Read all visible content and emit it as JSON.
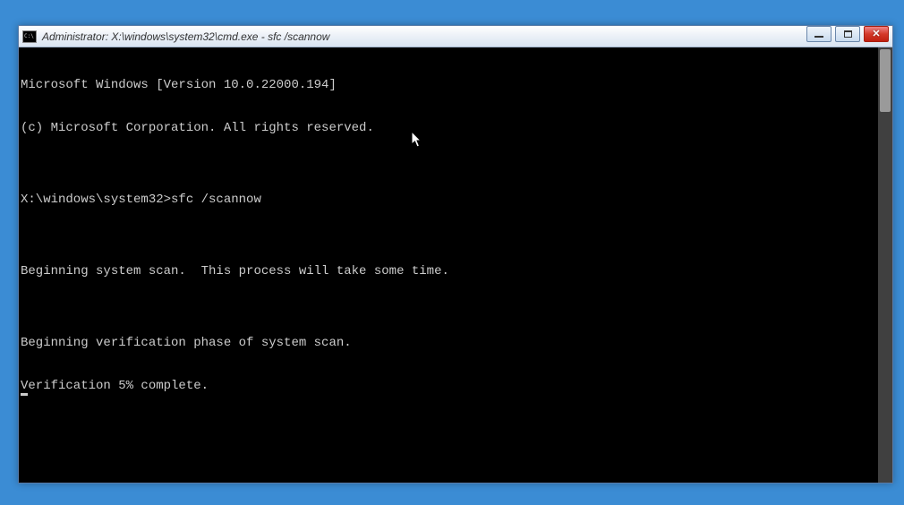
{
  "window": {
    "title": "Administrator: X:\\windows\\system32\\cmd.exe - sfc  /scannow",
    "icon_label": "cmd-icon"
  },
  "controls": {
    "minimize": "minimize-button",
    "maximize": "maximize-button",
    "close": "close-button"
  },
  "console": {
    "lines": [
      "Microsoft Windows [Version 10.0.22000.194]",
      "(c) Microsoft Corporation. All rights reserved.",
      "",
      "X:\\windows\\system32>sfc /scannow",
      "",
      "Beginning system scan.  This process will take some time.",
      "",
      "Beginning verification phase of system scan.",
      "Verification 5% complete."
    ],
    "prompt_path": "X:\\windows\\system32>",
    "command": "sfc /scannow",
    "progress_percent": 5
  }
}
